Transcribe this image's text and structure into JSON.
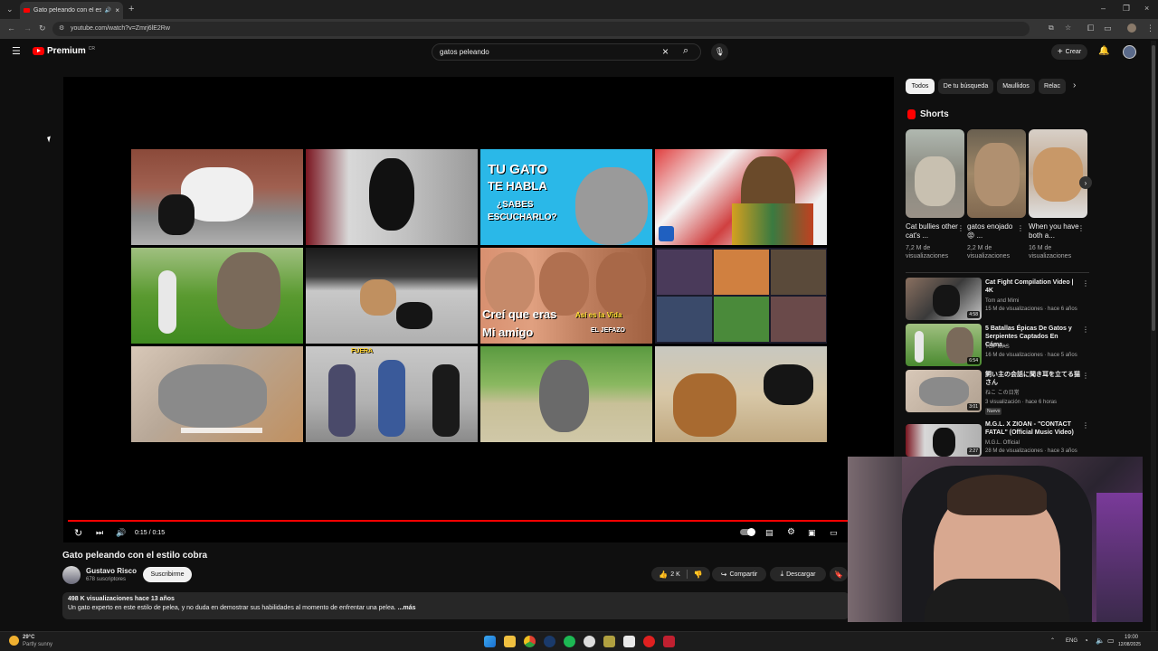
{
  "browser": {
    "tab_title": "Gato peleando con el estilo",
    "url": "youtube.com/watch?v=Zmrj6lE2Rw"
  },
  "header": {
    "logo_text": "Premium",
    "logo_sup": "CR",
    "search_value": "gatos peleando",
    "create_label": "Crear"
  },
  "player": {
    "time": "0:15 / 0:15",
    "progress": 1.0,
    "thumb_texts": {
      "tu_gato": "TU GATO",
      "te_habla": "TE HABLA",
      "sabes": "¿SABES",
      "escucharlo": "ESCUCHARLO?",
      "crei": "Creí que eras",
      "mi_amigo": "Mi amigo",
      "asi": "Así es la Vida",
      "jefazo": "EL JEFAZO",
      "fuera": "FUERA"
    }
  },
  "video": {
    "title": "Gato peleando con el estilo cobra",
    "channel": "Gustavo Risco",
    "subscribers": "678 suscriptores",
    "subscribe_label": "Suscribirme",
    "likes": "2 K",
    "share_label": "Compartir",
    "download_label": "Descargar",
    "views_date": "498 K visualizaciones  hace 13 años",
    "description": "Un gato experto en este estilo de pelea, y no duda en demostrar sus habilidades al momento de enfrentar una pelea.",
    "more_label": "...más"
  },
  "chips": [
    "Todos",
    "De tu búsqueda",
    "Maullidos",
    "Relac"
  ],
  "shorts": {
    "heading": "Shorts",
    "items": [
      {
        "title": "Cat bullies other cat's ...",
        "views": "7,2 M de visualizaciones"
      },
      {
        "title": "gatos enojado 😡 ...",
        "views": "2,2 M de visualizaciones"
      },
      {
        "title": "When you have both a...",
        "views": "16 M de visualizaciones"
      }
    ]
  },
  "recommended": [
    {
      "title": "Cat Fight Compilation Video | 4K",
      "channel": "Tom and Mimi",
      "meta": "15 M de visualizaciones · hace 6 años",
      "duration": "4:58",
      "badge": ""
    },
    {
      "title": "5 Batallas Épicas De Gatos y Serpientes Captados En Cáma...",
      "channel": "TOP MAS",
      "meta": "16 M de visualizaciones · hace 5 años",
      "duration": "6:54",
      "badge": ""
    },
    {
      "title": "飼い主の会話に聞き耳を立てる猫さん",
      "channel": "ねこ この日常",
      "meta": "3 visualización · hace 6 horas",
      "duration": "3:01",
      "badge": "Nuevo"
    },
    {
      "title": "M.G.L. X ZIOAN - \"CONTACT FATAL\" (Official Music Video)",
      "channel": "M.G.L. Official",
      "meta": "28 M de visualizaciones · hace 3 años",
      "duration": "2:27",
      "badge": ""
    }
  ],
  "taskbar": {
    "temp": "29°C",
    "weather": "Partly sunny",
    "lang": "ENG",
    "time": "19:00",
    "date": "12/08/2025"
  },
  "colors": {
    "accent": "#ff0000",
    "bg": "#0f0f0f",
    "chip_active": "#f1f1f1"
  }
}
